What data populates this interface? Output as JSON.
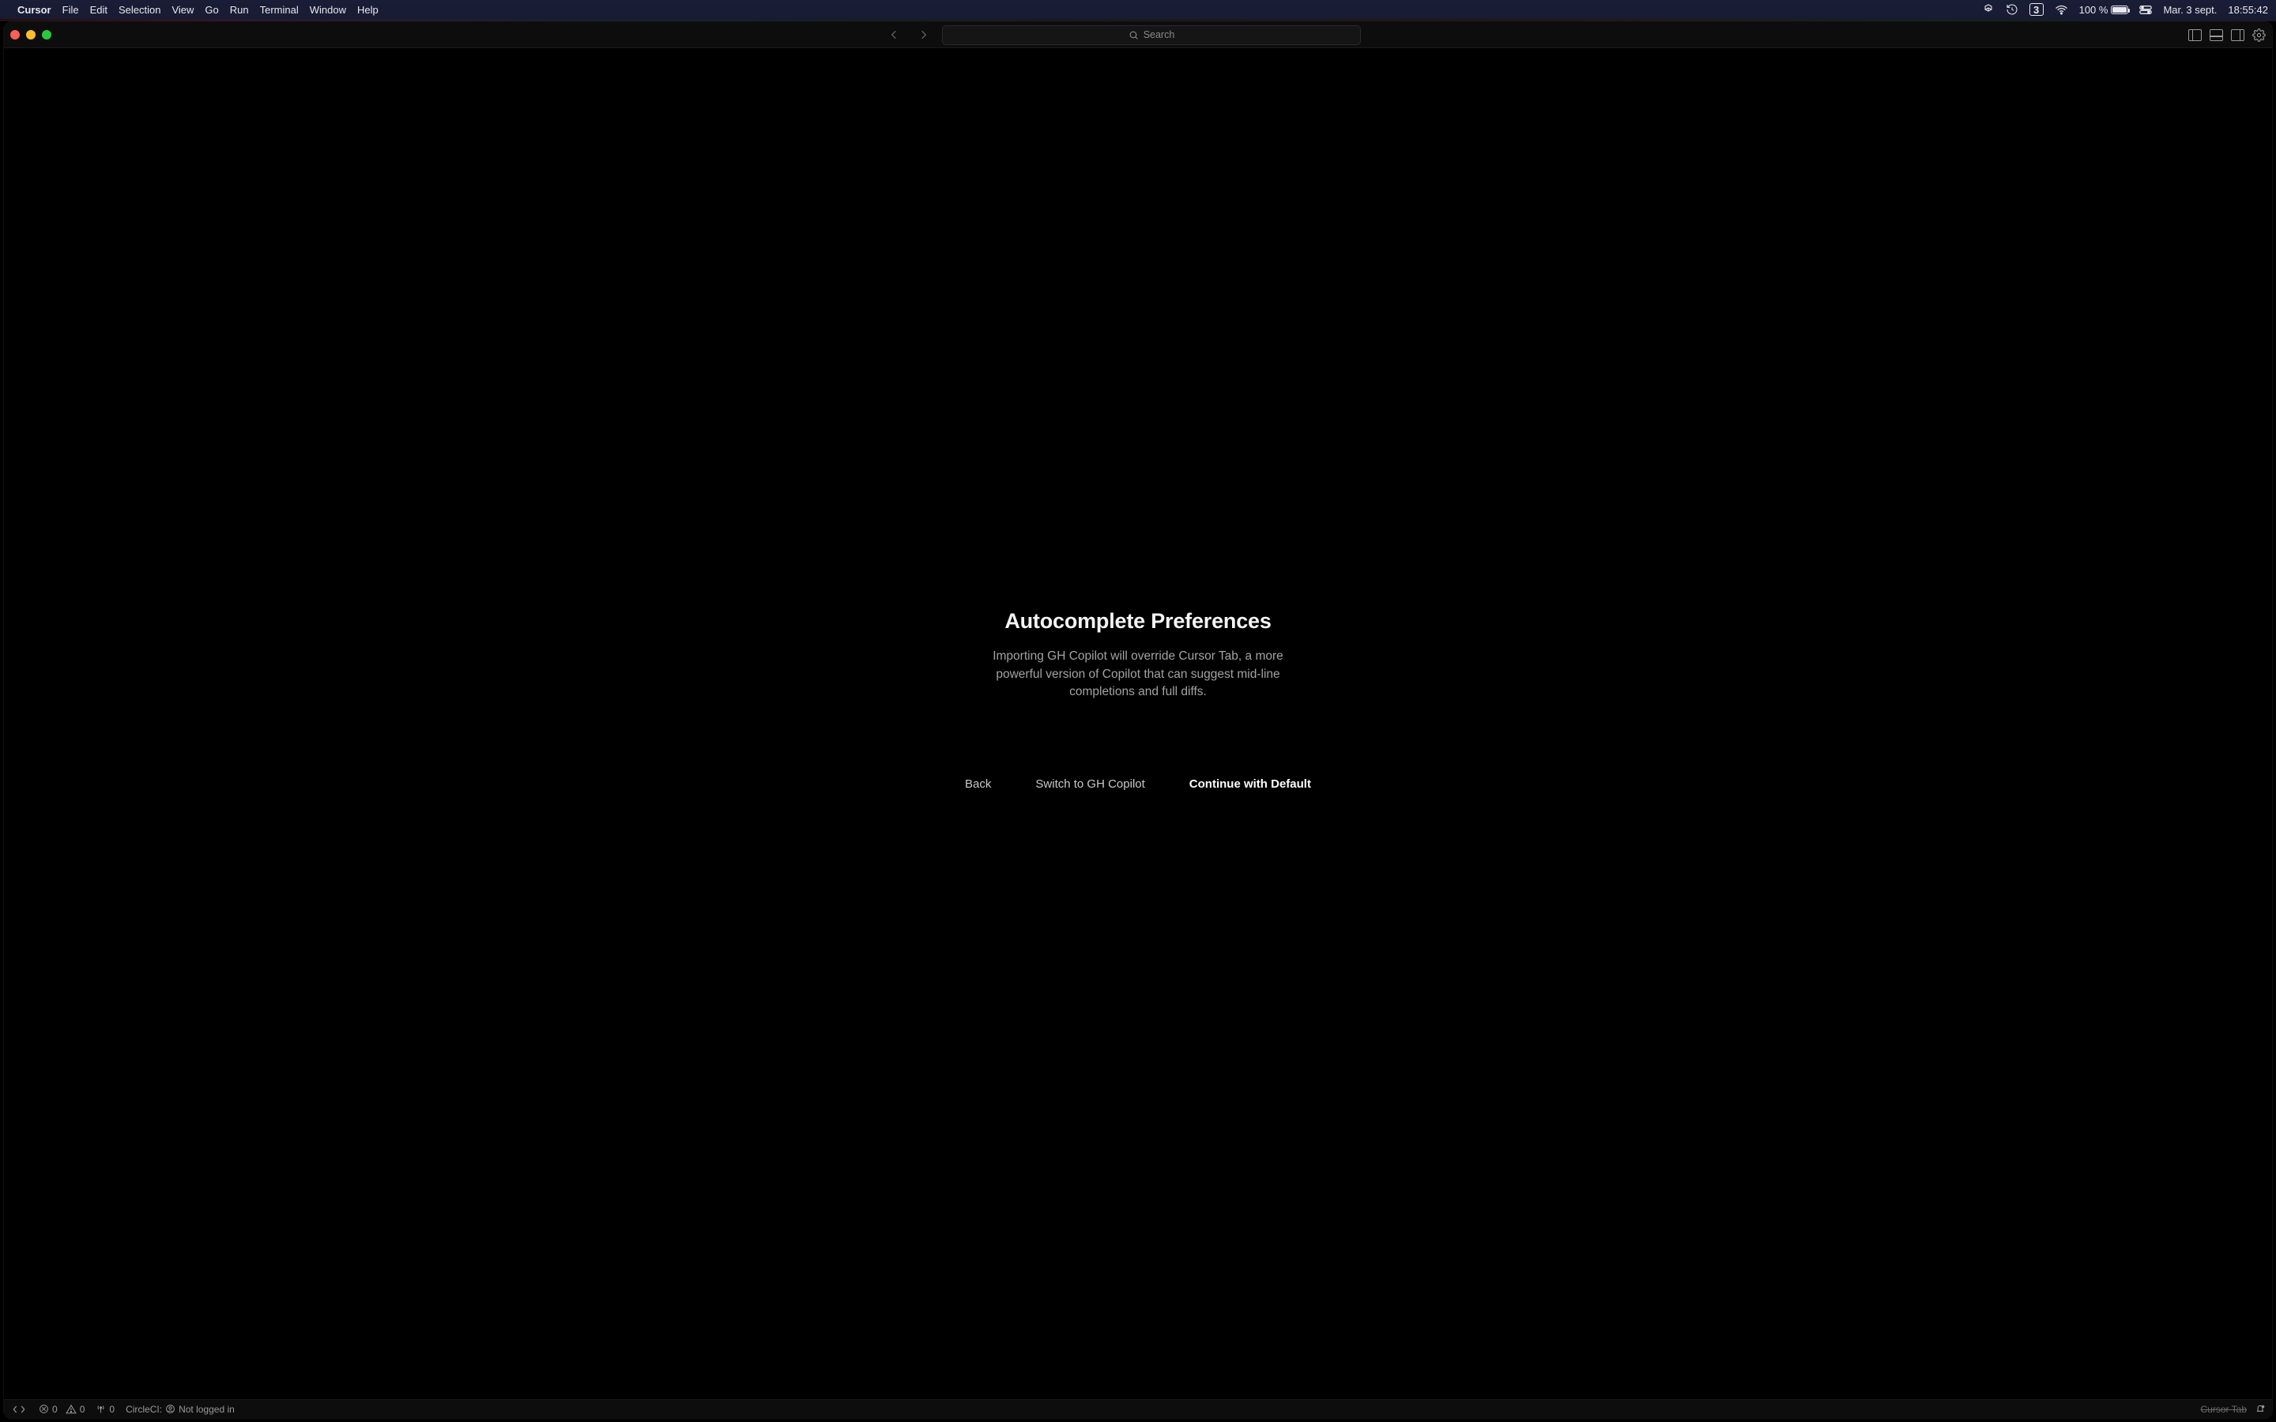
{
  "menubar": {
    "app_name": "Cursor",
    "items": [
      "File",
      "Edit",
      "Selection",
      "View",
      "Go",
      "Run",
      "Terminal",
      "Window",
      "Help"
    ],
    "right": {
      "battery_pct": "100 %",
      "date": "Mar. 3 sept.",
      "time": "18:55:42",
      "calendar_day": "3"
    }
  },
  "titlebar": {
    "search_placeholder": "Search"
  },
  "dialog": {
    "title": "Autocomplete Preferences",
    "body": "Importing GH Copilot will override Cursor Tab, a more powerful version of Copilot that can suggest mid-line completions and full diffs.",
    "back": "Back",
    "switch": "Switch to GH Copilot",
    "continue": "Continue with Default"
  },
  "statusbar": {
    "errors": "0",
    "warnings": "0",
    "ports": "0",
    "circleci_label": "CircleCI:",
    "circleci_status": "Not logged in",
    "cursor_tab": "Cursor Tab"
  }
}
